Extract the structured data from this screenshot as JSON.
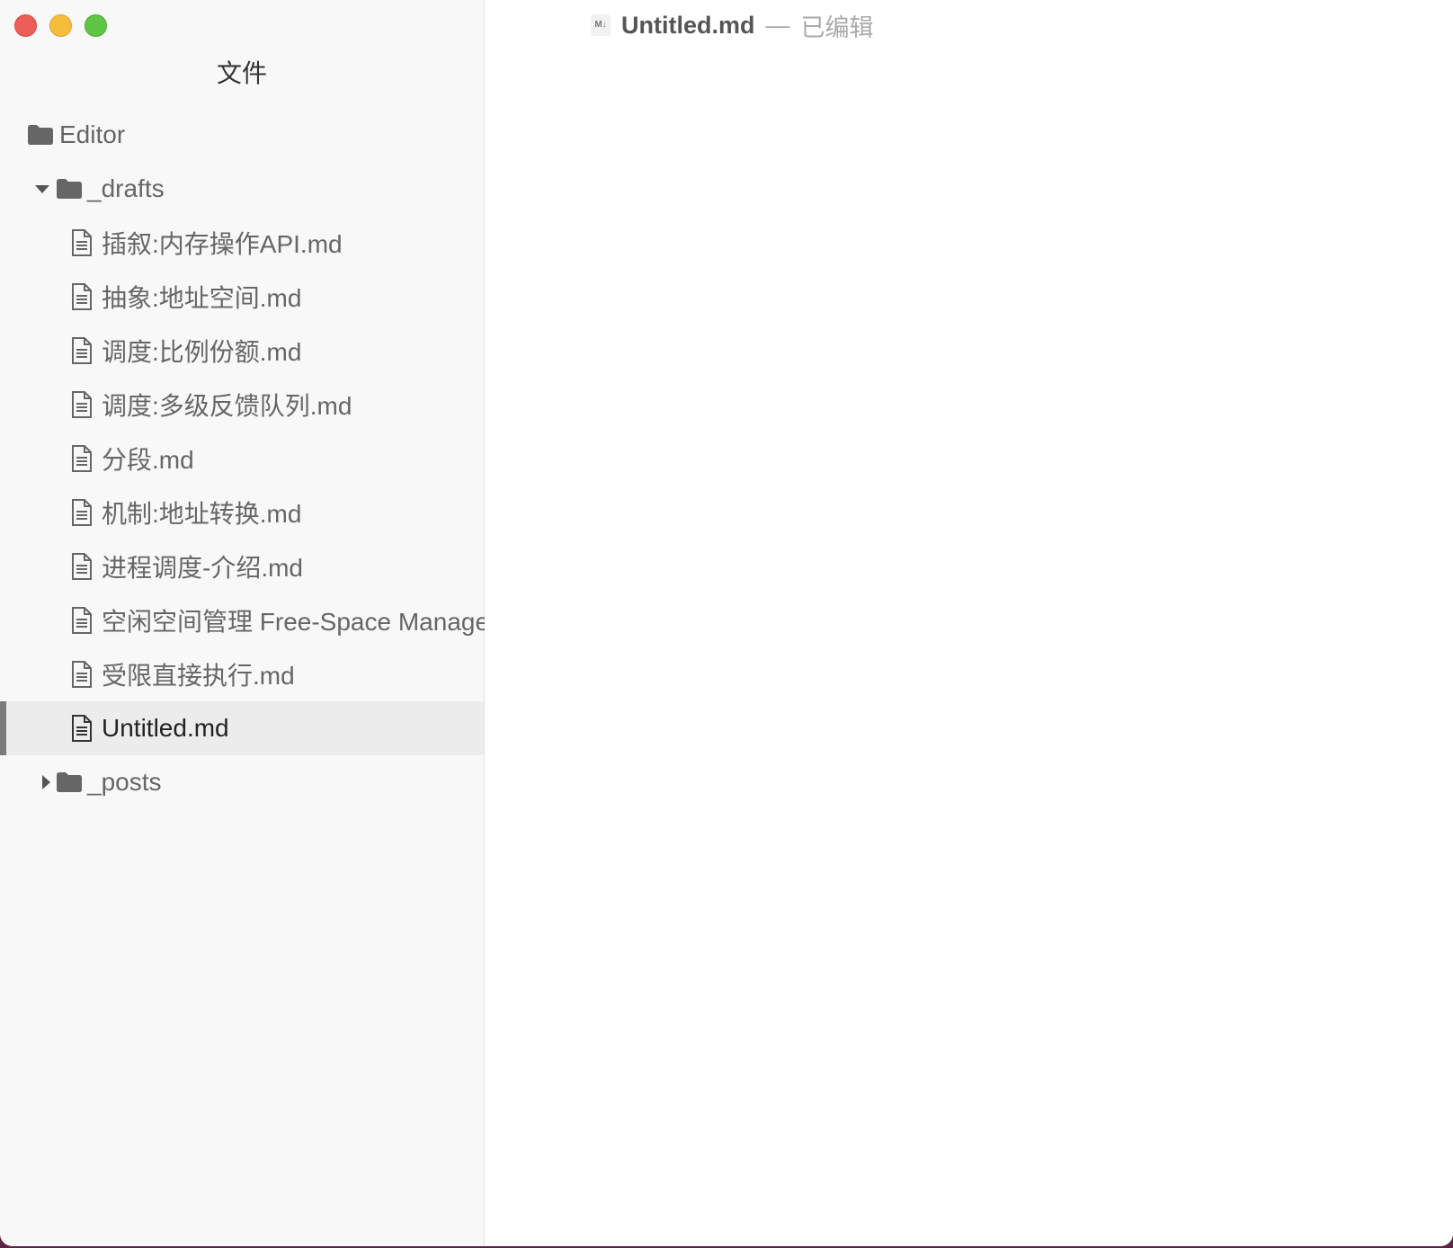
{
  "window": {
    "title": "Untitled.md",
    "separator": "—",
    "status": "已编辑",
    "md_badge": "M↓"
  },
  "sidebar": {
    "title": "文件",
    "root": "Editor",
    "drafts_folder": "_drafts",
    "drafts_files": [
      "插叙:内存操作API.md",
      "抽象:地址空间.md",
      "调度:比例份额.md",
      "调度:多级反馈队列.md",
      "分段.md",
      "机制:地址转换.md",
      "进程调度-介绍.md",
      "空闲空间管理 Free-Space Manage",
      "受限直接执行.md",
      "Untitled.md"
    ],
    "selected_file": "Untitled.md",
    "posts_folder": "_posts"
  },
  "icons": {
    "folder": "folder-icon",
    "file": "file-icon",
    "expanded": "chevron-down-icon",
    "collapsed": "chevron-right-icon",
    "markdown": "markdown-icon"
  }
}
